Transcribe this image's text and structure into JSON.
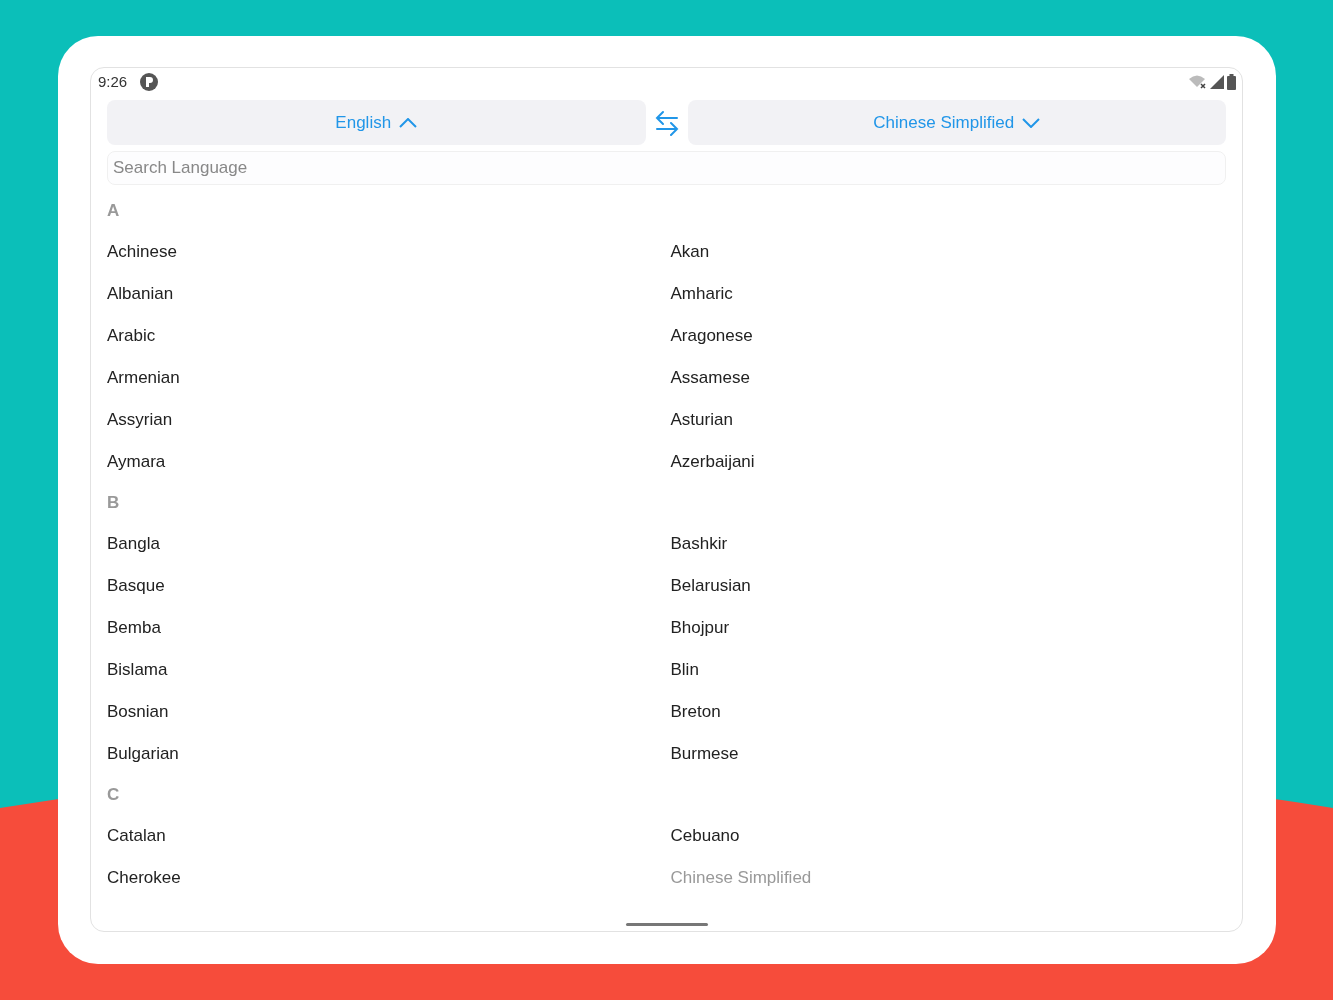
{
  "status_bar": {
    "time": "9:26"
  },
  "language_bar": {
    "source": "English",
    "target": "Chinese Simplified"
  },
  "search": {
    "placeholder": "Search Language"
  },
  "sections": [
    {
      "letter": "A",
      "items": [
        {
          "label": "Achinese",
          "disabled": false
        },
        {
          "label": "Akan",
          "disabled": false
        },
        {
          "label": "Albanian",
          "disabled": false
        },
        {
          "label": "Amharic",
          "disabled": false
        },
        {
          "label": "Arabic",
          "disabled": false
        },
        {
          "label": "Aragonese",
          "disabled": false
        },
        {
          "label": "Armenian",
          "disabled": false
        },
        {
          "label": "Assamese",
          "disabled": false
        },
        {
          "label": "Assyrian",
          "disabled": false
        },
        {
          "label": "Asturian",
          "disabled": false
        },
        {
          "label": "Aymara",
          "disabled": false
        },
        {
          "label": "Azerbaijani",
          "disabled": false
        }
      ]
    },
    {
      "letter": "B",
      "items": [
        {
          "label": "Bangla",
          "disabled": false
        },
        {
          "label": "Bashkir",
          "disabled": false
        },
        {
          "label": "Basque",
          "disabled": false
        },
        {
          "label": "Belarusian",
          "disabled": false
        },
        {
          "label": "Bemba",
          "disabled": false
        },
        {
          "label": "Bhojpur",
          "disabled": false
        },
        {
          "label": "Bislama",
          "disabled": false
        },
        {
          "label": "Blin",
          "disabled": false
        },
        {
          "label": "Bosnian",
          "disabled": false
        },
        {
          "label": "Breton",
          "disabled": false
        },
        {
          "label": "Bulgarian",
          "disabled": false
        },
        {
          "label": "Burmese",
          "disabled": false
        }
      ]
    },
    {
      "letter": "C",
      "items": [
        {
          "label": "Catalan",
          "disabled": false
        },
        {
          "label": "Cebuano",
          "disabled": false
        },
        {
          "label": "Cherokee",
          "disabled": false
        },
        {
          "label": "Chinese Simplified",
          "disabled": true
        }
      ]
    }
  ]
}
